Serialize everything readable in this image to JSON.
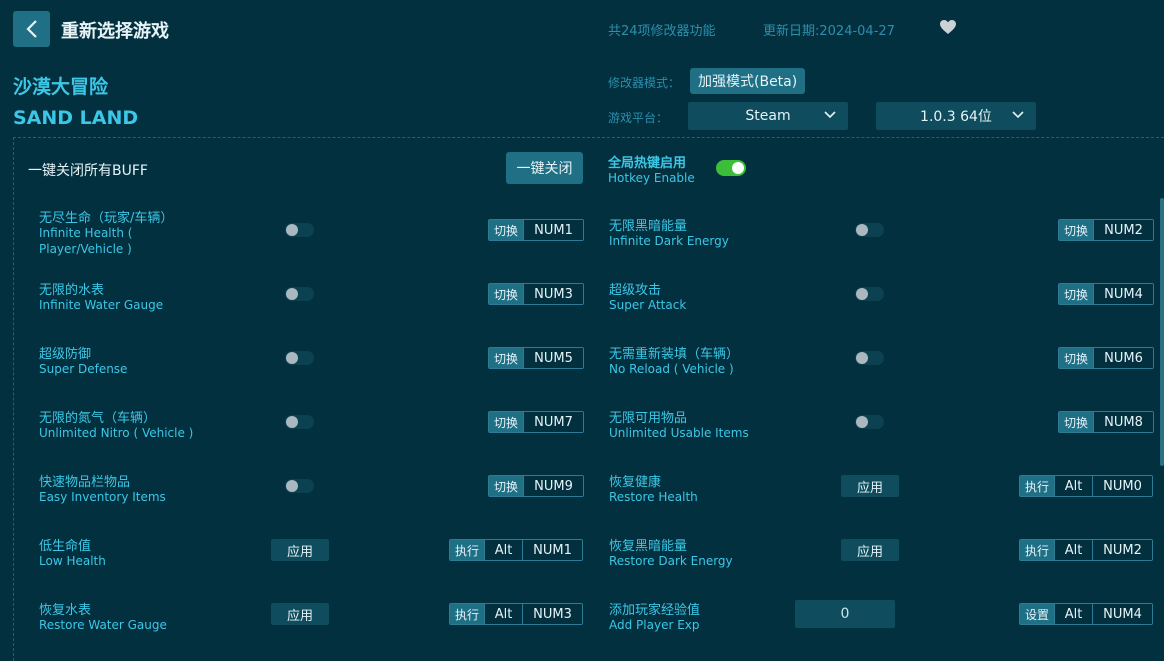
{
  "header": {
    "title": "重新选择游戏",
    "feature_count": "共24项修改器功能",
    "update_date": "更新日期:2024-04-27"
  },
  "game": {
    "name_cn": "沙漠大冒险",
    "name_en": "SAND LAND"
  },
  "settings": {
    "mode_label": "修改器模式：",
    "mode_value": "加强模式(Beta)",
    "platform_label": "游戏平台：",
    "platform_value": "Steam",
    "version_value": "1.0.3 64位"
  },
  "global": {
    "buff_label": "一键关闭所有BUFF",
    "close_all_label": "一键关闭",
    "hotkey_cn": "全局热键启用",
    "hotkey_en": "Hotkey Enable",
    "hotkey_enabled": true
  },
  "labels": {
    "toggle": "切换",
    "execute": "执行",
    "set": "设置",
    "apply": "应用",
    "alt": "Alt"
  },
  "options": {
    "o1": {
      "cn": "无尽生命（玩家/车辆）",
      "en": "Infinite Health (\nPlayer/Vehicle )",
      "key": "NUM1",
      "on": false
    },
    "o2": {
      "cn": "无限黑暗能量",
      "en": "Infinite Dark Energy",
      "key": "NUM2",
      "on": false
    },
    "o3": {
      "cn": "无限的水表",
      "en": "Infinite Water Gauge",
      "key": "NUM3",
      "on": false
    },
    "o4": {
      "cn": "超级攻击",
      "en": "Super Attack",
      "key": "NUM4",
      "on": false
    },
    "o5": {
      "cn": "超级防御",
      "en": "Super Defense",
      "key": "NUM5",
      "on": false
    },
    "o6": {
      "cn": "无需重新装填（车辆）",
      "en": "No Reload ( Vehicle )",
      "key": "NUM6",
      "on": false
    },
    "o7": {
      "cn": "无限的氮气（车辆）",
      "en": "Unlimited Nitro ( Vehicle )",
      "key": "NUM7",
      "on": false
    },
    "o8": {
      "cn": "无限可用物品",
      "en": "Unlimited Usable Items",
      "key": "NUM8",
      "on": false
    },
    "o9": {
      "cn": "快速物品栏物品",
      "en": "Easy Inventory Items",
      "key": "NUM9",
      "on": false
    },
    "o10": {
      "cn": "恢复健康",
      "en": "Restore Health",
      "key": "NUM0"
    },
    "o11": {
      "cn": "低生命值",
      "en": "Low Health",
      "key": "NUM1"
    },
    "o12": {
      "cn": "恢复黑暗能量",
      "en": "Restore Dark Energy",
      "key": "NUM2"
    },
    "o13": {
      "cn": "恢复水表",
      "en": "Restore Water Gauge",
      "key": "NUM3"
    },
    "o14": {
      "cn": "添加玩家经验值",
      "en": "Add Player Exp",
      "key": "NUM4",
      "value": "0"
    }
  },
  "colors": {
    "background": "#03303f",
    "accent": "#3cc7e6",
    "button": "#1f6f85",
    "toggle_on": "#3bbf3b"
  },
  "icons": {
    "back": "chevron-left-icon",
    "favorite": "heart-icon",
    "dropdown": "chevron-down-icon"
  }
}
